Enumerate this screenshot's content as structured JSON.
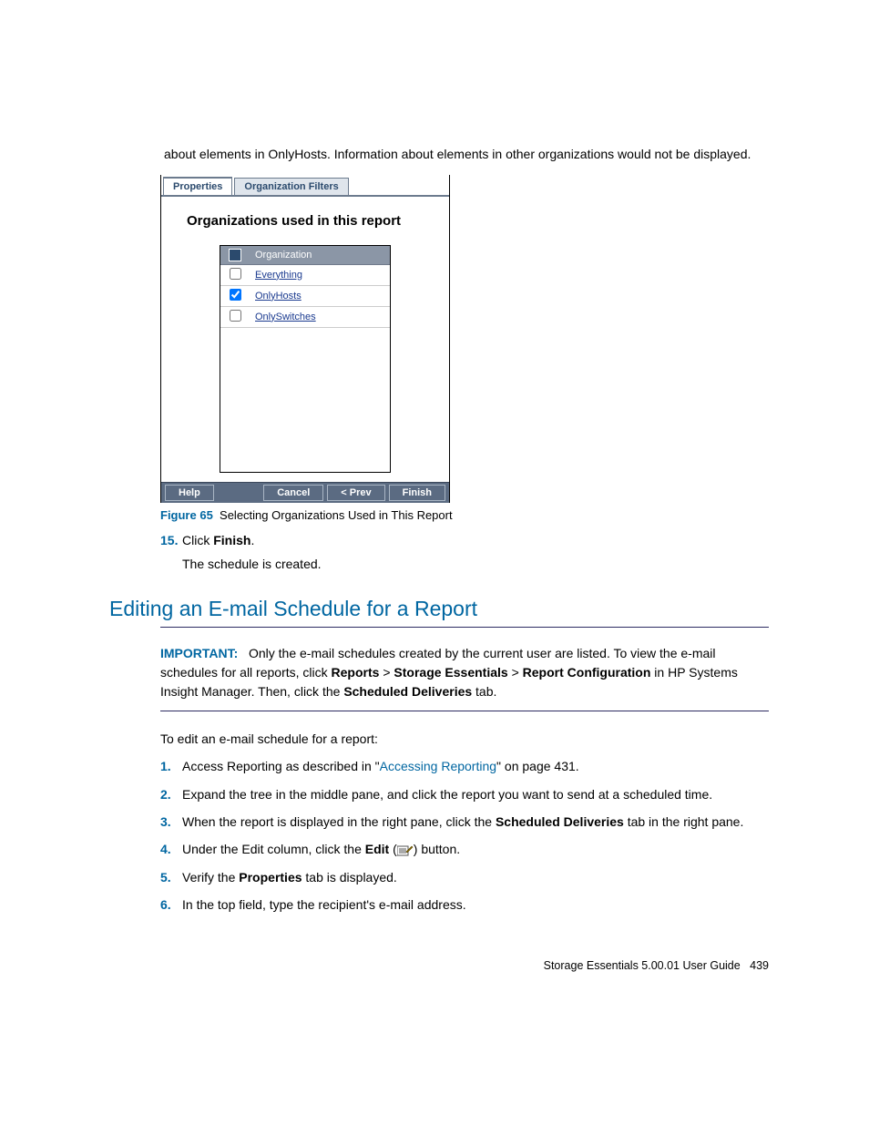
{
  "intro": "about elements in OnlyHosts. Information about elements in other organizations would not be displayed.",
  "panel": {
    "tabs": {
      "properties": "Properties",
      "orgfilters": "Organization Filters"
    },
    "heading": "Organizations used in this report",
    "columns": {
      "org": "Organization"
    },
    "rows": [
      {
        "label": "Everything",
        "checked": false
      },
      {
        "label": "OnlyHosts",
        "checked": true
      },
      {
        "label": "OnlySwitches",
        "checked": false
      }
    ],
    "buttons": {
      "help": "Help",
      "cancel": "Cancel",
      "prev": "< Prev",
      "finish": "Finish"
    }
  },
  "figure": {
    "num": "Figure 65",
    "caption": "Selecting Organizations Used in This Report"
  },
  "step15": {
    "num": "15.",
    "pre": "Click ",
    "bold": "Finish",
    "post": ".",
    "sub": "The schedule is created."
  },
  "section_heading": "Editing an E-mail Schedule for a Report",
  "important": {
    "label": "IMPORTANT:",
    "t1": "Only the e-mail schedules created by the current user are listed. To view the e-mail schedules for all reports, click ",
    "b1": "Reports",
    "gt1": " > ",
    "b2": "Storage Essentials",
    "gt2": " > ",
    "b3": "Report Configuration",
    "t2": " in HP Systems Insight Manager. Then, click the ",
    "b4": "Scheduled Deliveries",
    "t3": " tab."
  },
  "para_lead": "To edit an e-mail schedule for a report:",
  "steps": {
    "s1": {
      "num": "1.",
      "t1": "Access Reporting as described in \"",
      "link": "Accessing Reporting",
      "t2": "\" on page 431."
    },
    "s2": {
      "num": "2.",
      "t": "Expand the tree in the middle pane, and click the report you want to send at a scheduled time."
    },
    "s3": {
      "num": "3.",
      "t1": "When the report is displayed in the right pane, click the ",
      "b": "Scheduled Deliveries",
      "t2": " tab in the right pane."
    },
    "s4": {
      "num": "4.",
      "t1": "Under the Edit column, click the ",
      "b": "Edit",
      "t2": " (",
      "t3": ") button."
    },
    "s5": {
      "num": "5.",
      "t1": "Verify the ",
      "b": "Properties",
      "t2": " tab is displayed."
    },
    "s6": {
      "num": "6.",
      "t": "In the top field, type the recipient's e-mail address."
    }
  },
  "footer": {
    "title": "Storage Essentials 5.00.01 User Guide",
    "page": "439"
  }
}
